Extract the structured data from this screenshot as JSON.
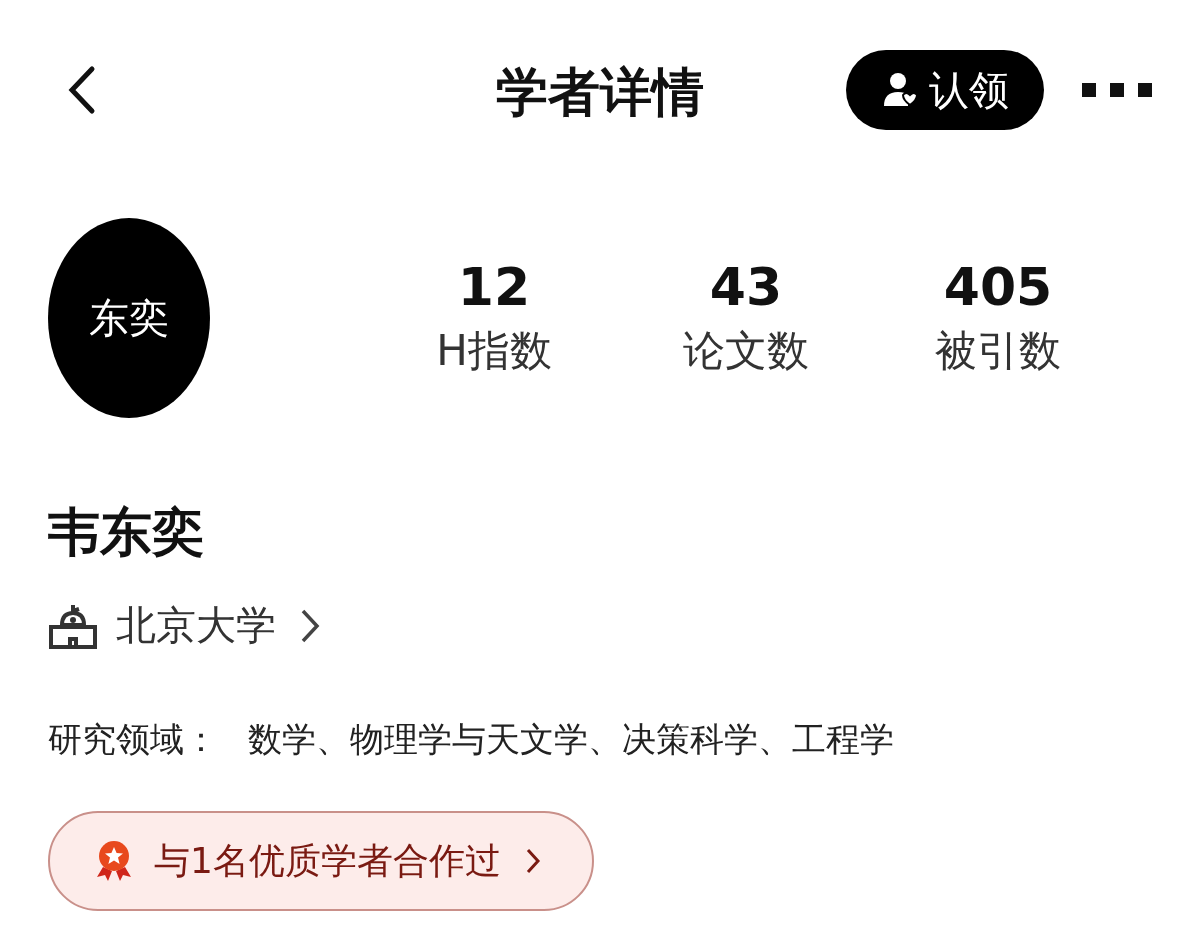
{
  "header": {
    "title": "学者详情",
    "claim_button": "认领"
  },
  "profile": {
    "avatar_text": "东奕",
    "name": "韦东奕"
  },
  "stats": [
    {
      "value": "12",
      "label": "H指数"
    },
    {
      "value": "43",
      "label": "论文数"
    },
    {
      "value": "405",
      "label": "被引数"
    }
  ],
  "institution": "北京大学",
  "research": {
    "label": "研究领域：",
    "value": "数学、物理学与天文学、决策科学、工程学"
  },
  "badge": "与1名优质学者合作过"
}
